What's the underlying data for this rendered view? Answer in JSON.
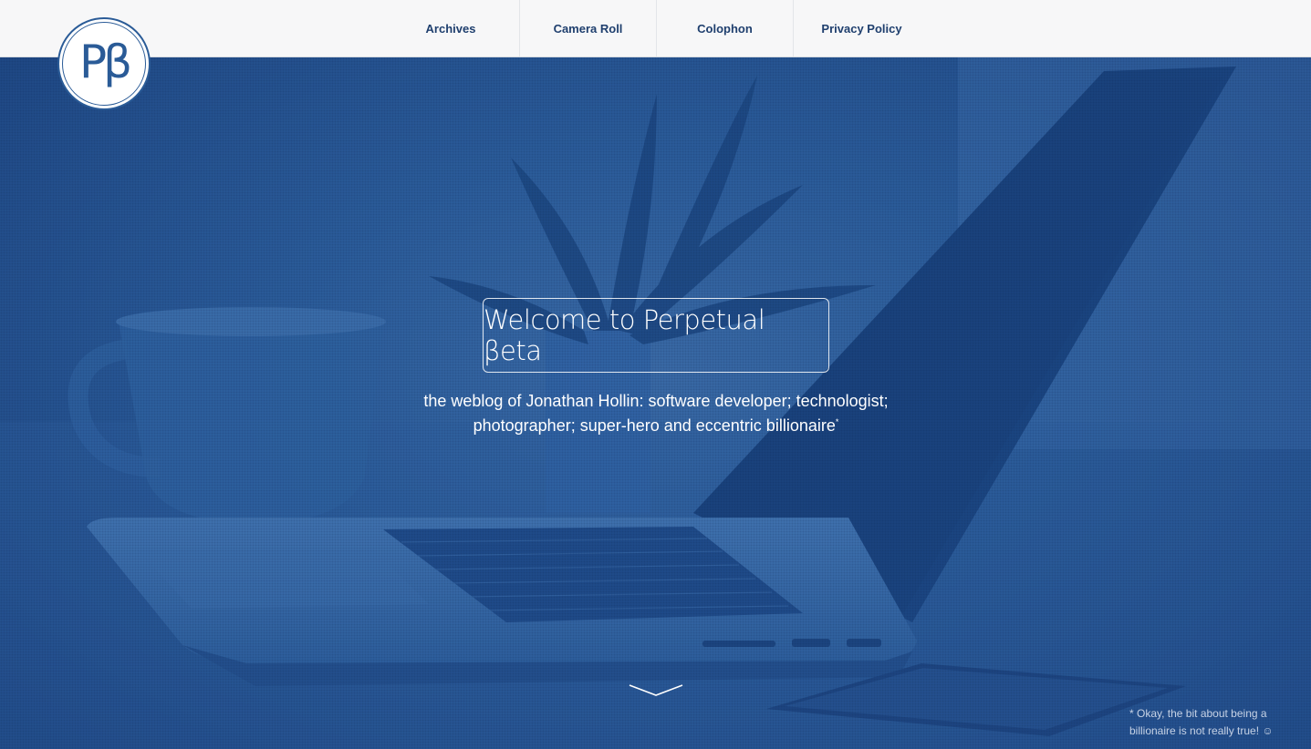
{
  "site": {
    "logo_text": "Pβ"
  },
  "nav": {
    "items": [
      {
        "label": "Archives"
      },
      {
        "label": "Camera Roll"
      },
      {
        "label": "Colophon"
      },
      {
        "label": "Privacy Policy"
      }
    ]
  },
  "hero": {
    "title": "Welcome to Perpetual βeta",
    "tagline_line1": "the weblog of Jonathan Hollin: software developer; technologist;",
    "tagline_line2": "photographer; super-hero and eccentric billionaire",
    "tagline_marker": "*",
    "scroll_icon": "chevron-down-icon",
    "footnote": "* Okay, the bit about being a billionaire is not really true! ☺"
  },
  "colors": {
    "nav_background": "#f7f7f8",
    "nav_text": "#1f3f6e",
    "hero_tint": "#2b5c9a",
    "logo_accent": "#2a5b97",
    "text_on_hero": "#ffffff"
  }
}
